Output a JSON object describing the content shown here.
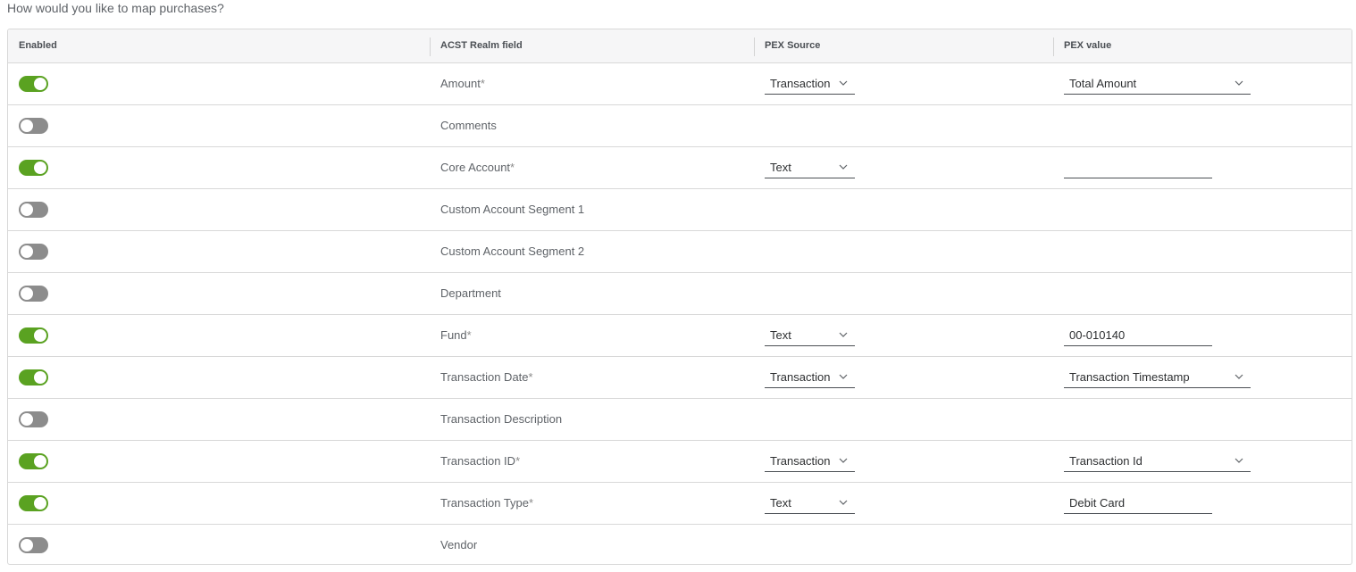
{
  "question": "How would you like to map purchases?",
  "columns": {
    "enabled": "Enabled",
    "realm_field": "ACST Realm field",
    "pex_source": "PEX Source",
    "pex_value": "PEX value"
  },
  "colors": {
    "toggle_on": "#5aa221",
    "toggle_off": "#8c8c8c"
  },
  "rows": [
    {
      "field": "Amount",
      "required": "*",
      "enabled": true,
      "source": "Transaction",
      "value_type": "select",
      "value": "Total Amount"
    },
    {
      "field": "Comments",
      "required": "",
      "enabled": false
    },
    {
      "field": "Core Account",
      "required": "*",
      "enabled": true,
      "source": "Text",
      "value_type": "input",
      "value": ""
    },
    {
      "field": "Custom Account Segment 1",
      "required": "",
      "enabled": false
    },
    {
      "field": "Custom Account Segment 2",
      "required": "",
      "enabled": false
    },
    {
      "field": "Department",
      "required": "",
      "enabled": false
    },
    {
      "field": "Fund",
      "required": "*",
      "enabled": true,
      "source": "Text",
      "value_type": "input",
      "value": "00-010140"
    },
    {
      "field": "Transaction Date",
      "required": "*",
      "enabled": true,
      "source": "Transaction",
      "value_type": "select",
      "value": "Transaction Timestamp"
    },
    {
      "field": "Transaction Description",
      "required": "",
      "enabled": false
    },
    {
      "field": "Transaction ID",
      "required": "*",
      "enabled": true,
      "source": "Transaction",
      "value_type": "select",
      "value": "Transaction Id"
    },
    {
      "field": "Transaction Type",
      "required": "*",
      "enabled": true,
      "source": "Text",
      "value_type": "input",
      "value": "Debit Card"
    },
    {
      "field": "Vendor",
      "required": "",
      "enabled": false
    }
  ]
}
